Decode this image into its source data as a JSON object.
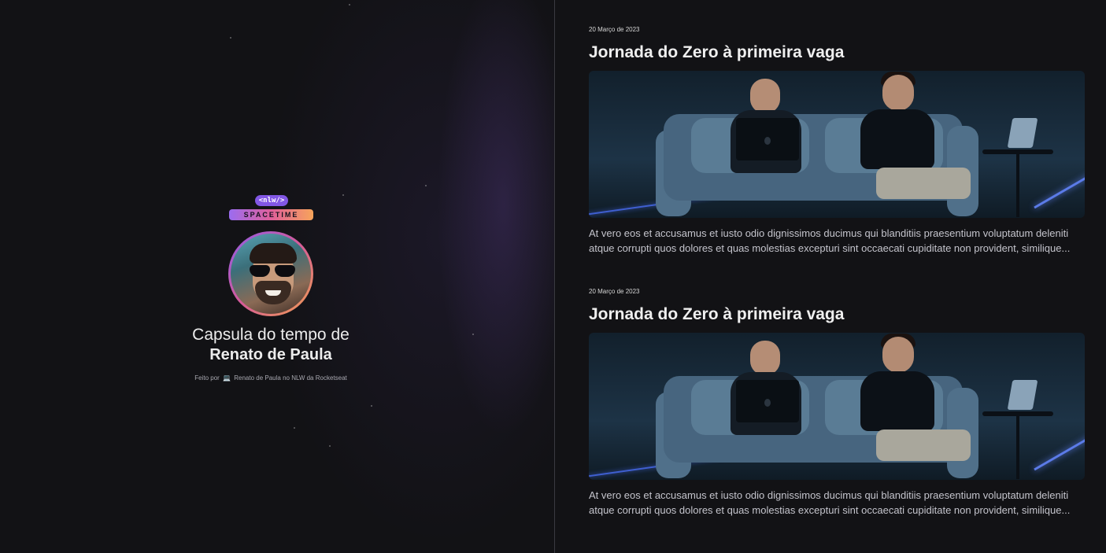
{
  "hero": {
    "logo_tag": "<nlw/>",
    "logo_word": "SPACETIME",
    "line1": "Capsula do tempo de",
    "line2": "Renato de Paula",
    "credit_prefix": "Feito por",
    "credit_icon": "laptop-icon",
    "credit_rest": "Renato de Paula no NLW da Rocketseat"
  },
  "posts": [
    {
      "date": "20 Março de 2023",
      "title": "Jornada do Zero à primeira vaga",
      "excerpt": "At vero eos et accusamus et iusto odio dignissimos ducimus qui blanditiis praesentium voluptatum deleniti atque corrupti quos dolores et quas molestias excepturi sint occaecati cupiditate non provident, similique..."
    },
    {
      "date": "20 Março de 2023",
      "title": "Jornada do Zero à primeira vaga",
      "excerpt": "At vero eos et accusamus et iusto odio dignissimos ducimus qui blanditiis praesentium voluptatum deleniti atque corrupti quos dolores et quas molestias excepturi sint occaecati cupiditate non provident, similique..."
    }
  ],
  "colors": {
    "background": "#121215",
    "brand_purple": "#8257e5",
    "brand_pink": "#e0609a",
    "brand_orange": "#f7a45a"
  }
}
